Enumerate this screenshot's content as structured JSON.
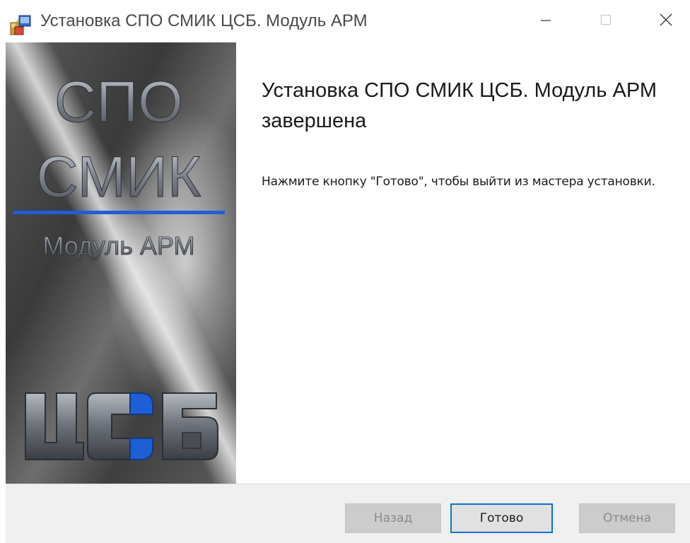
{
  "window": {
    "title": "Установка СПО СМИК ЦСБ. Модуль АРМ",
    "minimize_icon": "minimize-icon",
    "maximize_icon": "maximize-icon",
    "close_icon": "close-icon"
  },
  "banner": {
    "line1": "СПО",
    "line2": "СМИК",
    "line3": "Модуль АРМ",
    "logo": "ЦСБ",
    "accent_color": "#1f5fd6"
  },
  "content": {
    "heading": "Установка СПО СМИК ЦСБ. Модуль АРМ завершена",
    "description": "Нажмите кнопку \"Готово\", чтобы выйти из мастера установки."
  },
  "buttons": {
    "back": "Назад",
    "finish": "Готово",
    "cancel": "Отмена"
  }
}
